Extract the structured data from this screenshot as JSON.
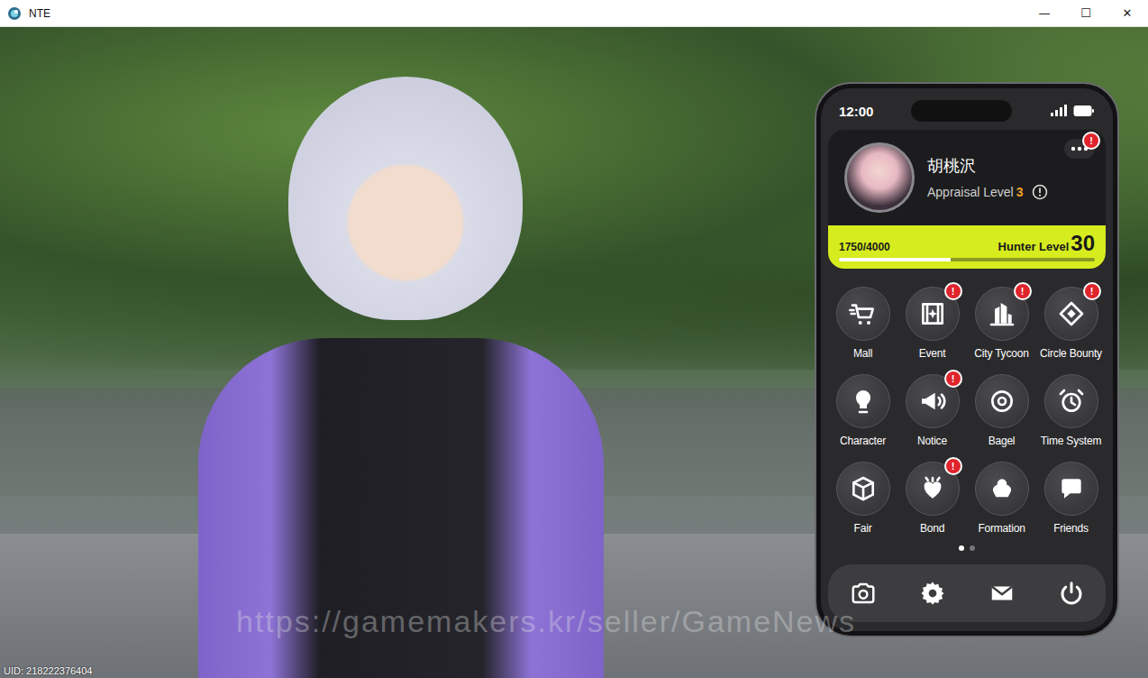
{
  "window": {
    "title": "NTE",
    "controls": [
      "—",
      "☐",
      "✕"
    ]
  },
  "watermark": "https://gamemakers.kr/seller/GameNews",
  "uid": "UID: 218222376404",
  "phone": {
    "status_bar": {
      "time": "12:00"
    },
    "alert_glyph": "!",
    "profile": {
      "name": "胡桃沢",
      "appraisal_label": "Appraisal Level",
      "appraisal_level": "3",
      "menu_alert": true,
      "xp": "1750/4000",
      "hunter_label": "Hunter Level",
      "hunter_level": "30",
      "level": 0.4375
    },
    "apps": [
      {
        "label": "Mall",
        "alert": false
      },
      {
        "label": "Event",
        "alert": true
      },
      {
        "label": "City Tycoon",
        "alert": true
      },
      {
        "label": "Circle Bounty",
        "alert": true
      },
      {
        "label": "Character",
        "alert": false
      },
      {
        "label": "Notice",
        "alert": true
      },
      {
        "label": "Bagel",
        "alert": false
      },
      {
        "label": "Time System",
        "alert": false
      },
      {
        "label": "Fair",
        "alert": false
      },
      {
        "label": "Bond",
        "alert": true
      },
      {
        "label": "Formation",
        "alert": false
      },
      {
        "label": "Friends",
        "alert": false
      }
    ],
    "pages": [
      {
        "selected": true
      },
      {
        "selected": false
      }
    ]
  }
}
